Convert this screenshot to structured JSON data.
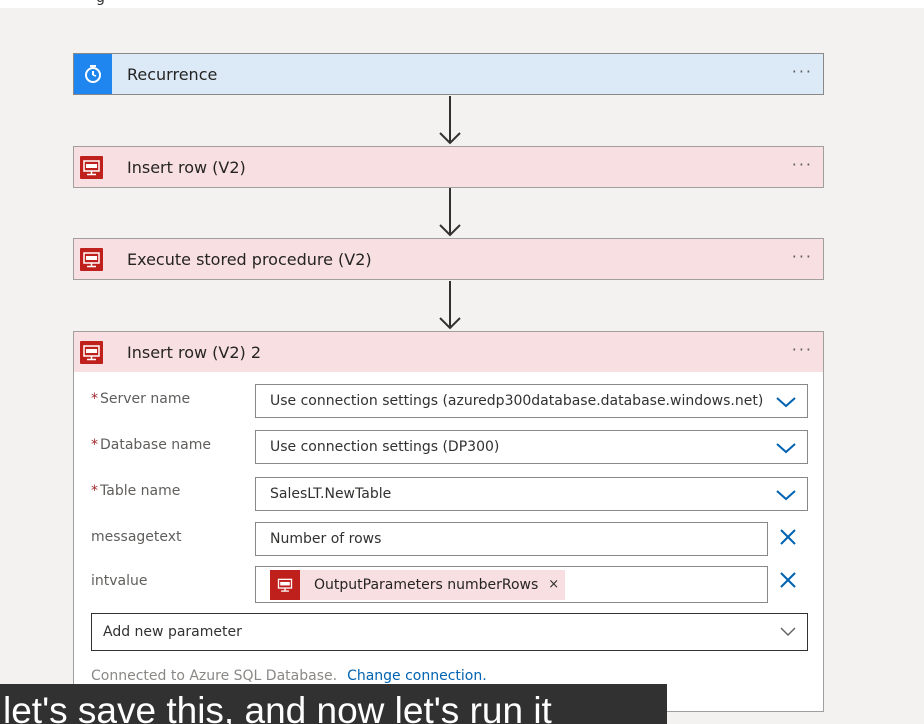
{
  "top_cut_text": "g",
  "steps": [
    {
      "title": "Recurrence",
      "more": "···"
    },
    {
      "title": "Insert row (V2)",
      "more": "···"
    },
    {
      "title": "Execute stored procedure (V2)",
      "more": "···"
    },
    {
      "title": "Insert row (V2) 2",
      "more": "···"
    }
  ],
  "form": {
    "server_label": "Server name",
    "server_value": "Use connection settings (azuredp300database.database.windows.net)",
    "database_label": "Database name",
    "database_value": "Use connection settings (DP300)",
    "table_label": "Table name",
    "table_value": "SalesLT.NewTable",
    "messagetext_label": "messagetext",
    "messagetext_value": "Number of rows",
    "intvalue_label": "intvalue",
    "intvalue_token": "OutputParameters numberRows",
    "token_remove": "×",
    "required_mark": "*",
    "add_param_label": "Add new parameter"
  },
  "footer": {
    "connected_text": "Connected to Azure SQL Database.",
    "change_link": "Change connection."
  },
  "caption": "let's save this, and now let's run it",
  "colors": {
    "accent_blue": "#1f85ef",
    "sql_red": "#c0201c",
    "link": "#0063b1"
  },
  "icons": {
    "recurrence": "clock-icon",
    "sql": "sql-database-icon",
    "chevron": "chevron-down-icon",
    "clear": "close-icon",
    "arrow": "arrow-down-icon"
  }
}
